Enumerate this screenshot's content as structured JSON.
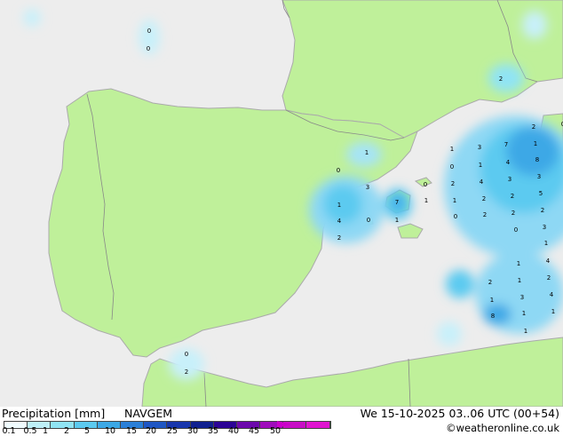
{
  "map": {
    "colors": {
      "sea": "#ededed",
      "land": "#bff09a",
      "coast": "#aaaaaa",
      "border": "#888888"
    },
    "precip_values": [
      "0",
      "0",
      "2",
      "1",
      "0",
      "3",
      "1",
      "4",
      "0",
      "2",
      "7",
      "1",
      "0",
      "1",
      "1",
      "3",
      "7",
      "1",
      "0",
      "1",
      "4",
      "8",
      "2",
      "4",
      "3",
      "3",
      "1",
      "2",
      "2",
      "5",
      "0",
      "2",
      "2",
      "2",
      "2",
      "0",
      "3",
      "1",
      "1",
      "4",
      "2",
      "1",
      "2",
      "1",
      "3",
      "4",
      "8",
      "1",
      "1",
      "0",
      "0",
      "2",
      "1"
    ]
  },
  "footer": {
    "title": "Precipitation [mm]",
    "model": "NAVGEM",
    "datetime": "We 15-10-2025 03..06 UTC (00+54)",
    "credit": "©weatheronline.co.uk",
    "scale_labels": [
      "0.1",
      "0.5",
      "1",
      "2",
      "5",
      "10",
      "15",
      "20",
      "25",
      "30",
      "35",
      "40",
      "45",
      "50"
    ],
    "scale_colors": [
      "#f0fcff",
      "#bef0f8",
      "#90e4f4",
      "#5ccaf0",
      "#3ca8e6",
      "#2a7fd8",
      "#1f56c4",
      "#1836ac",
      "#102090",
      "#2c0496",
      "#6c08ac",
      "#a00cbc",
      "#c80ec6",
      "#e014d0"
    ]
  }
}
